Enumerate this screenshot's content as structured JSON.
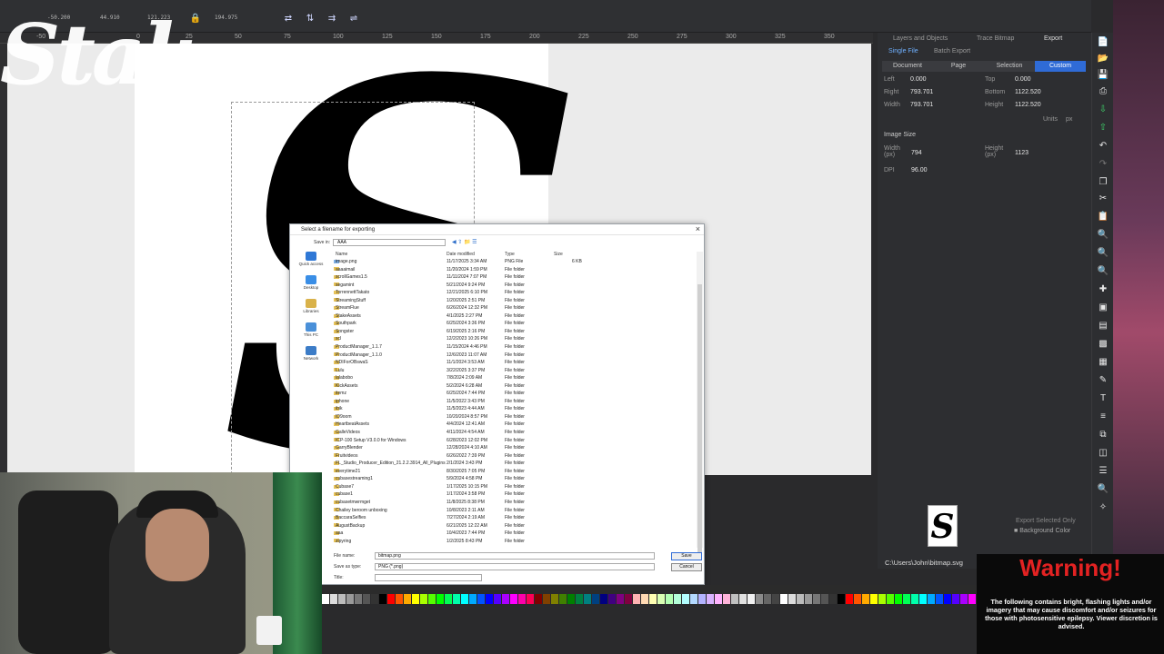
{
  "toolbar": {
    "fields": [
      "-50.200",
      "44.910",
      "121.223",
      "194.975"
    ],
    "ruler_ticks": [
      "-50",
      "0",
      "25",
      "50",
      "75",
      "100",
      "125",
      "150",
      "175",
      "200",
      "225",
      "250",
      "275",
      "300",
      "325",
      "350"
    ]
  },
  "logo_text": "Stak",
  "dialog": {
    "title": "Select a filename for exporting",
    "save_in_label": "Save in:",
    "save_in_value": "AAA",
    "places": [
      "Quick access",
      "Desktop",
      "Libraries",
      "This PC",
      "Network"
    ],
    "columns": [
      "Name",
      "Date modified",
      "Type",
      "Size"
    ],
    "rows": [
      {
        "name": "image.png",
        "date": "11/17/2025 3:34 AM",
        "type": "PNG File",
        "size": "6 KB"
      },
      {
        "name": "aaaaimail",
        "date": "11/20/2024 1:59 PM",
        "type": "File folder",
        "size": ""
      },
      {
        "name": "scrollGames1.5",
        "date": "11/11/2024 7:07 PM",
        "type": "File folder",
        "size": ""
      },
      {
        "name": "segamint",
        "date": "5/21/2024 9:24 PM",
        "type": "File folder",
        "size": ""
      },
      {
        "name": "TorrennettTakato",
        "date": "12/21/2025 6:10 PM",
        "type": "File folder",
        "size": ""
      },
      {
        "name": "StreamingStuff",
        "date": "1/20/2025 2:51 PM",
        "type": "File folder",
        "size": ""
      },
      {
        "name": "StreamFlue",
        "date": "6/26/2024 12:32 PM",
        "type": "File folder",
        "size": ""
      },
      {
        "name": "StakeAssets",
        "date": "4/1/2025 2:27 PM",
        "type": "File folder",
        "size": ""
      },
      {
        "name": "Southpark",
        "date": "6/25/2024 3:36 PM",
        "type": "File folder",
        "size": ""
      },
      {
        "name": "Songster",
        "date": "6/19/2025 2:16 PM",
        "type": "File folder",
        "size": ""
      },
      {
        "name": "scl",
        "date": "12/2/2023 10:26 PM",
        "type": "File folder",
        "size": ""
      },
      {
        "name": "ProductManager_1.1.7",
        "date": "11/15/2024 4:46 PM",
        "type": "File folder",
        "size": ""
      },
      {
        "name": "ProductManager_1.1.0",
        "date": "12/6/2023 11:07 AM",
        "type": "File folder",
        "size": ""
      },
      {
        "name": "NDIForOBswaS",
        "date": "11/1/2024 3:53 AM",
        "type": "File folder",
        "size": ""
      },
      {
        "name": "Lulu",
        "date": "3/22/2025 3:37 PM",
        "type": "File folder",
        "size": ""
      },
      {
        "name": "lalabobo",
        "date": "7/8/2024 2:09 AM",
        "type": "File folder",
        "size": ""
      },
      {
        "name": "KickAssets",
        "date": "5/2/2024 6:28 AM",
        "type": "File folder",
        "size": ""
      },
      {
        "name": "itemz",
        "date": "6/25/2024 7:44 PM",
        "type": "File folder",
        "size": ""
      },
      {
        "name": "iphone",
        "date": "11/5/2022 3:43 PM",
        "type": "File folder",
        "size": ""
      },
      {
        "name": "ibik",
        "date": "11/5/2023 4:44 AM",
        "type": "File folder",
        "size": ""
      },
      {
        "name": "ID9oom",
        "date": "10/20/2024 8:57 PM",
        "type": "File folder",
        "size": ""
      },
      {
        "name": "HeartbeatAssets",
        "date": "4/4/2024 12:41 AM",
        "type": "File folder",
        "size": ""
      },
      {
        "name": "GalleVideos",
        "date": "4/11/2024 4:54 AM",
        "type": "File folder",
        "size": ""
      },
      {
        "name": "ICP-100 Setup V3.0.0 for Windows",
        "date": "6/28/2023 12:02 PM",
        "type": "File folder",
        "size": ""
      },
      {
        "name": "GarryBlender",
        "date": "12/28/2024 4:10 AM",
        "type": "File folder",
        "size": ""
      },
      {
        "name": "Fruitvideos",
        "date": "6/26/2022 7:39 PM",
        "type": "File folder",
        "size": ""
      },
      {
        "name": "FL_Studio_Producer_Edition_21.2.2.3914_All_Plugins",
        "date": "2/1/2024 3:43 PM",
        "type": "File folder",
        "size": ""
      },
      {
        "name": "everytime21",
        "date": "8/30/2025 7:05 PM",
        "type": "File folder",
        "size": ""
      },
      {
        "name": "cubasestreaming1",
        "date": "5/9/2024 4:58 PM",
        "type": "File folder",
        "size": ""
      },
      {
        "name": "Cubase7",
        "date": "1/17/2025 10:15 PM",
        "type": "File folder",
        "size": ""
      },
      {
        "name": "cubase1",
        "date": "1/17/2024 3:58 PM",
        "type": "File folder",
        "size": ""
      },
      {
        "name": "cubasetmwrmget",
        "date": "11/8/2025 8:38 PM",
        "type": "File folder",
        "size": ""
      },
      {
        "name": "Chailey beroom unboxing",
        "date": "10/8/2023 2:11 AM",
        "type": "File folder",
        "size": ""
      },
      {
        "name": "BaccaraSelfies",
        "date": "7/27/2024 2:19 AM",
        "type": "File folder",
        "size": ""
      },
      {
        "name": "AugustBackup",
        "date": "6/21/2025 12:22 AM",
        "type": "File folder",
        "size": ""
      },
      {
        "name": "aaa",
        "date": "10/4/2023 7:44 PM",
        "type": "File folder",
        "size": ""
      },
      {
        "name": "zipyring",
        "date": "1/2/2025 8:43 PM",
        "type": "File folder",
        "size": ""
      }
    ],
    "file_name_label": "File name:",
    "file_name_value": "bitmap.png",
    "save_as_label": "Save as type:",
    "save_as_value": "PNG (*.png)",
    "title_label": "Title:",
    "save_button": "Save",
    "cancel_button": "Cancel"
  },
  "panel": {
    "tabs": [
      "Layers and Objects",
      "Trace Bitmap",
      "Export"
    ],
    "export_modes": [
      "Single File",
      "Batch Export"
    ],
    "areas": [
      "Document",
      "Page",
      "Selection",
      "Custom"
    ],
    "left_label": "Left",
    "left_value": "0.000",
    "top_label": "Top",
    "top_value": "0.000",
    "right_label": "Right",
    "right_value": "793.701",
    "bottom_label": "Bottom",
    "bottom_value": "1122.520",
    "width_label": "Width",
    "width_value": "793.701",
    "height_label": "Height",
    "height_value": "1122.520",
    "units_label": "Units",
    "units_value": "px",
    "image_size_title": "Image Size",
    "img_width_label": "Width (px)",
    "img_width_value": "794",
    "img_height_label": "Height (px)",
    "img_height_value": "1123",
    "dpi_label": "DPI",
    "dpi_value": "96.00",
    "export_selected_only": "Export Selected Only",
    "background_color": "Background Color",
    "path": "C:\\Users\\John\\bitmap.svg"
  },
  "warning": {
    "title": "Warning!",
    "body": "The following contains bright, flashing lights and/or imagery that may cause discomfort and/or seizures for those with photosensitive epilepsy. Viewer discretion is advised."
  },
  "colors": {
    "accent": "#2f6bd6",
    "warning_red": "#e32222",
    "panel_bg": "#2d2e31"
  }
}
